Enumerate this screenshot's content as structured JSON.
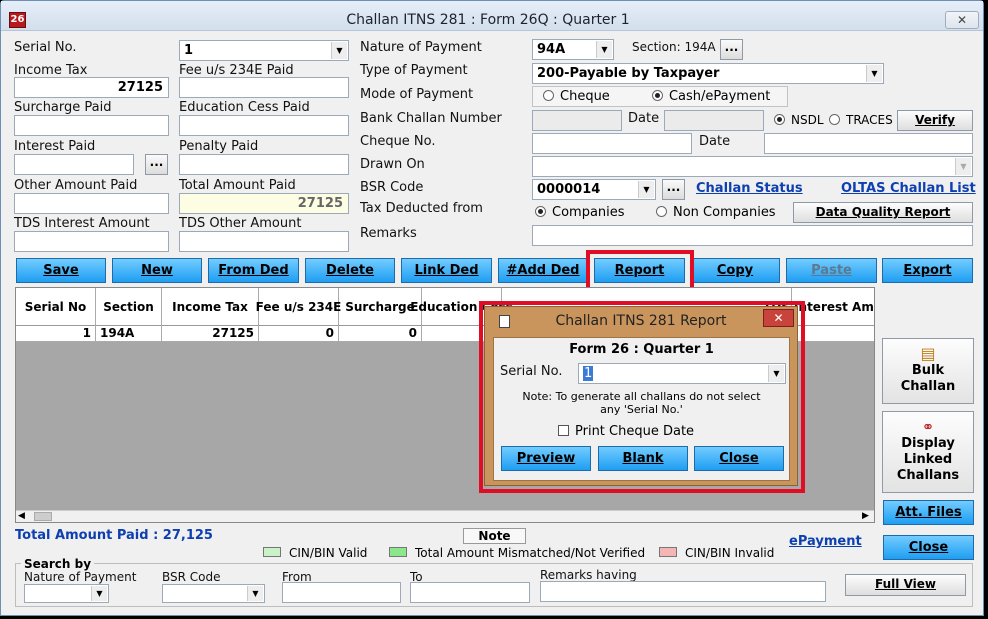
{
  "window": {
    "app_icon_text": "26",
    "title": "Challan ITNS 281 : Form 26Q : Quarter 1",
    "close_label": "✕"
  },
  "left": {
    "serial_label": "Serial No.",
    "serial_value": "1",
    "income_tax_label": "Income Tax",
    "income_tax_value": "27125",
    "fee_label": "Fee u/s 234E Paid",
    "fee_value": "",
    "surcharge_label": "Surcharge Paid",
    "surcharge_value": "",
    "edu_cess_label": "Education Cess Paid",
    "edu_cess_value": "",
    "interest_label": "Interest Paid",
    "interest_value": "",
    "penalty_label": "Penalty Paid",
    "penalty_value": "",
    "other_amount_label": "Other Amount Paid",
    "other_amount_value": "",
    "total_amount_label": "Total Amount Paid",
    "total_amount_value": "27125",
    "tds_interest_label": "TDS Interest Amount",
    "tds_interest_value": "",
    "tds_other_label": "TDS Other Amount",
    "tds_other_value": "",
    "dots": "..."
  },
  "right": {
    "nature_label": "Nature of Payment",
    "nature_value": "94A",
    "section_label": "Section: 194A",
    "type_label": "Type of Payment",
    "type_value": "200-Payable by Taxpayer",
    "mode_label": "Mode of Payment",
    "mode_cheque": "Cheque",
    "mode_cash": "Cash/ePayment",
    "bank_challan_label": "Bank Challan Number",
    "date_label": "Date",
    "nsdl": "NSDL",
    "traces": "TRACES",
    "verify": "Verify",
    "cheque_no_label": "Cheque No.",
    "cheque_date_label": "Date",
    "drawn_on_label": "Drawn On",
    "bsr_label": "BSR Code",
    "bsr_value": "0000014",
    "challan_status": "Challan Status",
    "oltas": "OLTAS Challan List",
    "tds_from_label": "Tax Deducted from",
    "companies": "Companies",
    "non_companies": "Non Companies",
    "dq_report": "Data Quality Report",
    "remarks_label": "Remarks",
    "dots": "..."
  },
  "toolbar": [
    "Save",
    "New",
    "From Ded",
    "Delete",
    "Link Ded",
    "#Add Ded",
    "Report",
    "Copy",
    "Paste",
    "Export"
  ],
  "grid": {
    "headers": [
      "Serial No",
      "Section",
      "Income Tax",
      "Fee u/s 234E",
      "Surcharge",
      "Education Cess",
      "TDS Interest Amount"
    ],
    "row": [
      "1",
      "194A",
      "27125",
      "0",
      "0",
      ""
    ]
  },
  "side_buttons": {
    "bulk": "Bulk Challan",
    "display": "Display Linked Challans",
    "att_files": "Att. Files",
    "close": "Close"
  },
  "footer": {
    "total": "Total Amount Paid : 27,125",
    "note": "Note",
    "epayment": "ePayment",
    "legend": [
      "CIN/BIN Valid",
      "Total Amount Mismatched/Not Verified",
      "CIN/BIN Invalid"
    ],
    "legend_colors": [
      "#c9f2c9",
      "#8ce68c",
      "#f4b5b5"
    ],
    "search_by": "Search by",
    "s_nature": "Nature of Payment",
    "s_bsr": "BSR Code",
    "s_from": "From",
    "s_to": "To",
    "s_remarks": "Remarks having",
    "full_view": "Full View"
  },
  "dialog": {
    "title": "Challan ITNS 281 Report",
    "close": "✕",
    "heading": "Form 26 : Quarter 1",
    "serial_label": "Serial No.",
    "serial_value": "1",
    "note_line1": "Note: To generate all challans do not select",
    "note_line2": "any 'Serial No.'",
    "print_cheque": "Print Cheque Date",
    "preview": "Preview",
    "blank": "Blank",
    "close_btn": "Close"
  }
}
